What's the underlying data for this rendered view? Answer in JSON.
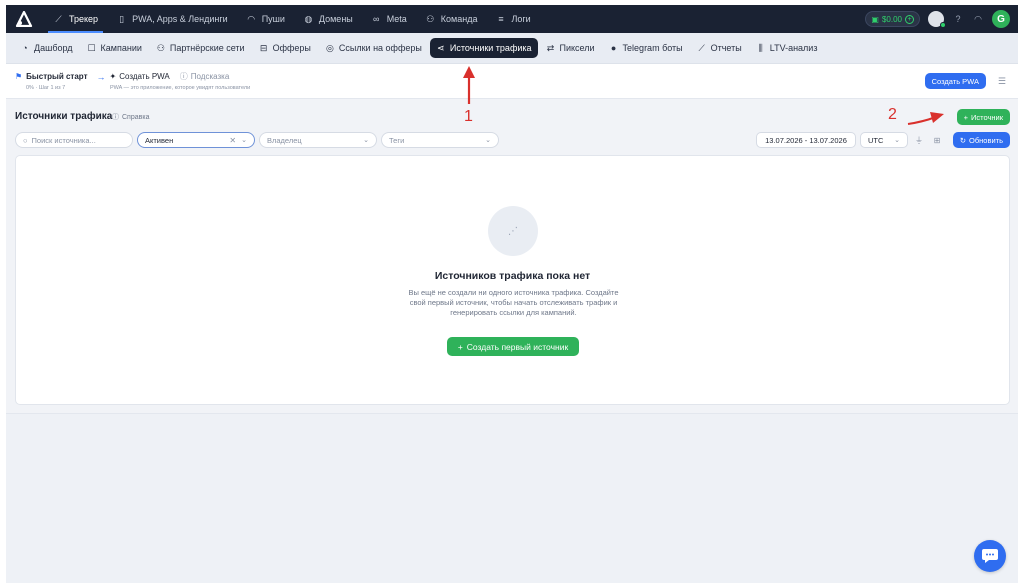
{
  "topbar": {
    "nav": [
      {
        "label": "Трекер",
        "icon": "chart-line-icon",
        "active": true
      },
      {
        "label": "PWA, Apps & Лендинги",
        "icon": "phone-icon",
        "active": false
      },
      {
        "label": "Пуши",
        "icon": "bell-icon",
        "active": false
      },
      {
        "label": "Домены",
        "icon": "globe-icon",
        "active": false
      },
      {
        "label": "Meta",
        "icon": "meta-icon",
        "active": false
      },
      {
        "label": "Команда",
        "icon": "team-icon",
        "active": false
      },
      {
        "label": "Логи",
        "icon": "list-icon",
        "active": false
      }
    ],
    "balance": "$0.00",
    "user_initial": "G"
  },
  "subnav": [
    {
      "label": "Дашборд",
      "icon": "dashboard-icon",
      "active": false
    },
    {
      "label": "Кампании",
      "icon": "edit-icon",
      "active": false
    },
    {
      "label": "Партнёрские сети",
      "icon": "partners-icon",
      "active": false
    },
    {
      "label": "Офферы",
      "icon": "offers-icon",
      "active": false
    },
    {
      "label": "Ссылки на офферы",
      "icon": "pin-icon",
      "active": false
    },
    {
      "label": "Источники трафика",
      "icon": "share-icon",
      "active": true
    },
    {
      "label": "Пиксели",
      "icon": "swap-icon",
      "active": false
    },
    {
      "label": "Telegram боты",
      "icon": "telegram-icon",
      "active": false
    },
    {
      "label": "Отчеты",
      "icon": "report-icon",
      "active": false
    },
    {
      "label": "LTV-анализ",
      "icon": "bar-chart-icon",
      "active": false
    }
  ],
  "quickstart": {
    "title": "Быстрый старт",
    "step": "Создать PWA",
    "hint": "Подсказка",
    "progress": "0% · Шаг 1 из 7",
    "description": "PWA — это приложение, которое увидят пользователи",
    "create_pwa": "Создать PWA"
  },
  "page": {
    "title": "Источники трафика",
    "help": "Справка",
    "add_button": "Источник"
  },
  "filters": {
    "search_placeholder": "Поиск источника...",
    "status": "Активен",
    "owner": "Владелец",
    "tags": "Теги",
    "date_range": "13.07.2026 - 13.07.2026",
    "timezone": "UTC",
    "refresh": "Обновить"
  },
  "empty": {
    "title": "Источников трафика пока нет",
    "text": "Вы ещё не создали ни одного источника трафика. Создайте свой первый источник, чтобы начать отслеживать трафик и генерировать ссылки для кампаний.",
    "button": "Создать первый источник"
  },
  "annotations": {
    "label_1": "1",
    "label_2": "2",
    "color": "#d9302c"
  }
}
